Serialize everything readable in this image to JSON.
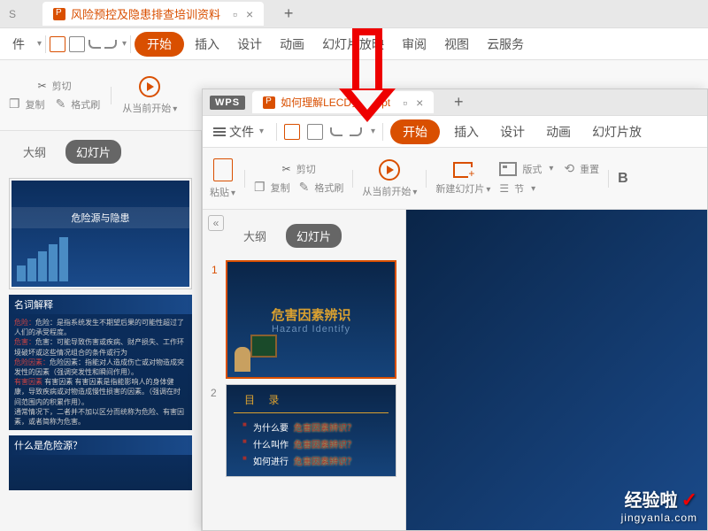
{
  "window1": {
    "tab_title": "风险预控及隐患排查培训资料",
    "menubar": {
      "file": "件",
      "start": "开始",
      "insert": "插入",
      "design": "设计",
      "animation": "动画",
      "slideshow": "幻灯片放映",
      "review": "审阅",
      "view": "视图",
      "cloud": "云服务"
    },
    "toolbar": {
      "cut": "剪切",
      "copy": "复制",
      "format_painter": "格式刷",
      "play_from_current": "从当前开始"
    },
    "sidebar": {
      "outline": "大纲",
      "slides": "幻灯片",
      "slide1_title": "危险源与隐患",
      "slide2_header": "名词解释",
      "slide2_body_l1": "危险：是指系统发生不期望后果的可能性超过了人们的承受程度。",
      "slide2_body_l2": "危害：可能导致伤害或疾病、财产损失、工作环境破坏或这些情况组合的条件或行为",
      "slide2_body_l3": "危险因素：指能对人造成伤亡或对物造成突发性的因素（强调突发性和瞬间作用）。",
      "slide2_body_l4": "有害因素  有害因素是指能影响人的身体健康，导致疾病或对物造成慢性损害的因素。（强调在时间范围内的积累作用）。",
      "slide2_body_l5": "通常情况下，二者并不加以区分而统称为危险、有害因素，或者简称为危害。",
      "slide3_header": "什么是危险源？"
    }
  },
  "window2": {
    "wps": "WPS",
    "tab_title": "如何理解LECD实案.ppt",
    "menubar": {
      "file": "文件",
      "start": "开始",
      "insert": "插入",
      "design": "设计",
      "animation": "动画",
      "slideshow": "幻灯片放"
    },
    "toolbar": {
      "paste": "粘贴",
      "cut": "剪切",
      "copy": "复制",
      "format_painter": "格式刷",
      "play_from_current": "从当前开始",
      "new_slide": "新建幻灯片",
      "layout": "版式",
      "reset": "重置",
      "section": "节"
    },
    "sidebar": {
      "outline": "大纲",
      "slides": "幻灯片",
      "slide1_num": "1",
      "slide1_title": "危害因素辨识",
      "slide1_sub": "Hazard  Identify",
      "slide2_num": "2",
      "slide2_toc_title": "目 录",
      "slide2_item1_a": "为什么要",
      "slide2_item1_b": "危害因素辨识？",
      "slide2_item2_a": "什么叫作",
      "slide2_item2_b": "危害因素辨识？",
      "slide2_item3_a": "如何进行",
      "slide2_item3_b": "危害因素辨识？"
    }
  },
  "watermark": {
    "big": "经验啦",
    "small": "jingyanla.com"
  }
}
